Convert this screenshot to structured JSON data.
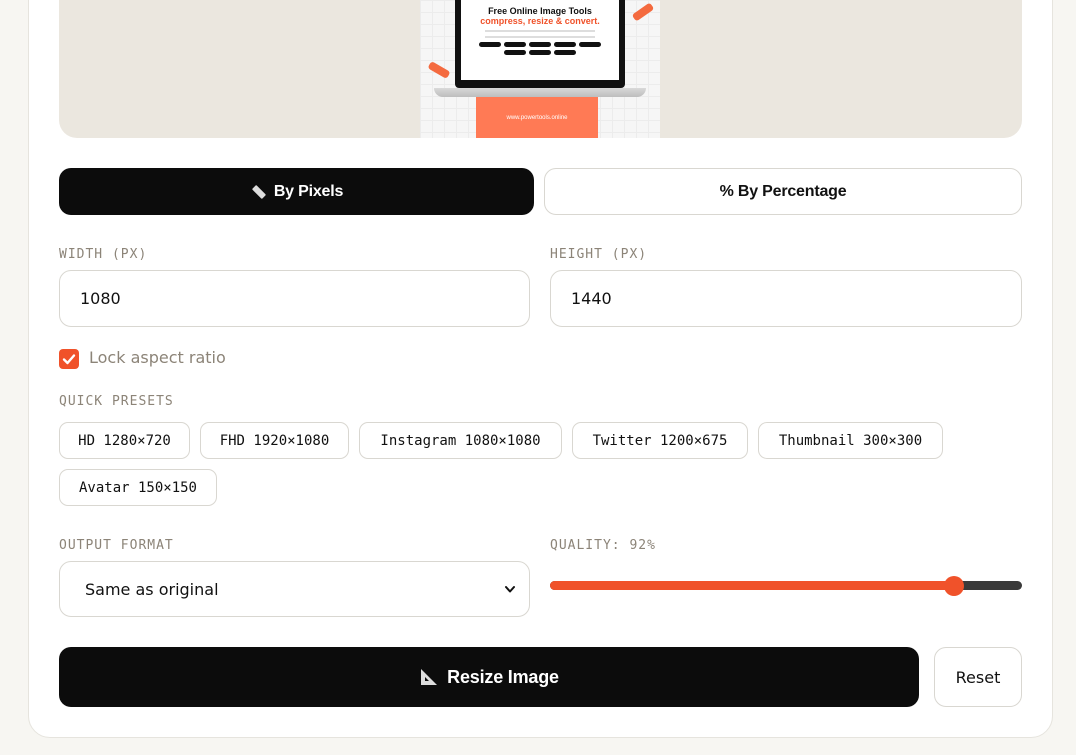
{
  "preview": {
    "title": "Free Online Image Tools",
    "subtitle": "compress, resize & convert.",
    "banner": "www.powertools.online"
  },
  "mode": {
    "by_pixels": "By Pixels",
    "by_percentage": "% By Percentage",
    "active": "by_pixels"
  },
  "dimensions": {
    "width_label": "WIDTH (PX)",
    "width_value": "1080",
    "height_label": "HEIGHT (PX)",
    "height_value": "1440"
  },
  "lock_aspect": {
    "label": "Lock aspect ratio",
    "checked": true
  },
  "presets": {
    "label": "QUICK PRESETS",
    "items": [
      "HD 1280×720",
      "FHD 1920×1080",
      "Instagram 1080×1080",
      "Twitter 1200×675",
      "Thumbnail 300×300",
      "Avatar 150×150"
    ]
  },
  "output": {
    "format_label": "OUTPUT FORMAT",
    "format_value": "Same as original",
    "quality_label": "QUALITY: 92%",
    "quality": 92
  },
  "actions": {
    "resize": "Resize Image",
    "reset": "Reset"
  },
  "colors": {
    "accent": "#f0522a",
    "dark": "#0c0c0c",
    "muted": "#8c8478"
  }
}
